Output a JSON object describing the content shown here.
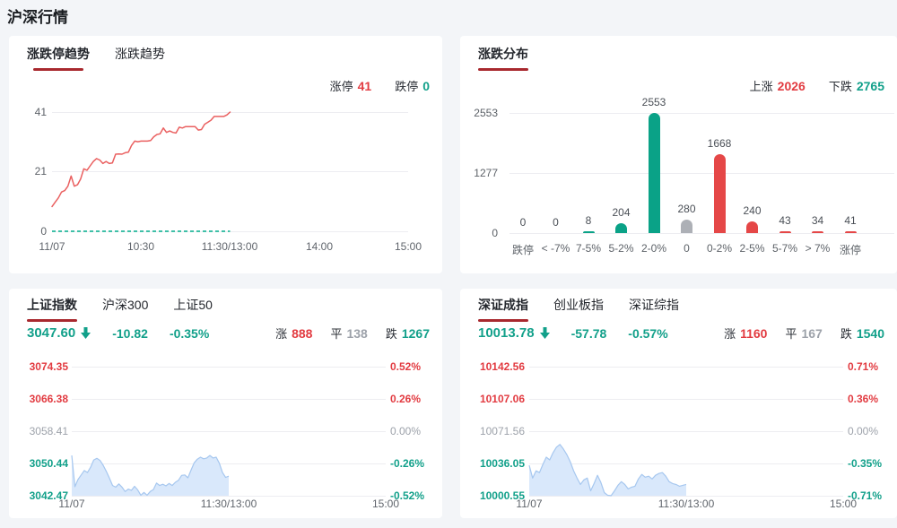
{
  "page": {
    "title": "沪深行情"
  },
  "colors": {
    "up": "#e23b41",
    "down": "#12a08a",
    "flat": "#9da2aa",
    "tab_underline": "#a8282e",
    "line_red": "#ea6060",
    "line_teal": "#3fc0a7",
    "bar_up": "#e54747",
    "bar_down": "#0aa287",
    "bar_flat": "#adb0b6",
    "area_fill": "#d9e8fb",
    "area_stroke": "#a6c7ef"
  },
  "panels": {
    "limit_trend": {
      "tabs": [
        "涨跌停趋势",
        "涨跌趋势"
      ],
      "stats": {
        "up_label": "涨停",
        "up_value": "41",
        "down_label": "跌停",
        "down_value": "0"
      },
      "chart": {
        "type": "line",
        "ymax": 41,
        "yticks": [
          "41",
          "21",
          "0"
        ],
        "xticks": [
          "11/07",
          "10:30",
          "11:30/13:00",
          "14:00",
          "15:00"
        ],
        "time_fraction_end": 0.5,
        "series": [
          {
            "name": "涨停",
            "tone": "up",
            "values": [
              8.5,
              10,
              11.5,
              13.5,
              14,
              15.5,
              19,
              15.5,
              16,
              18,
              21.5,
              21,
              22.5,
              24,
              25,
              24.5,
              23.3,
              24,
              23.3,
              23.5,
              26.5,
              26.6,
              26.5,
              27,
              27.2,
              29.5,
              31,
              30.8,
              31,
              31,
              31,
              31.2,
              32.5,
              33.3,
              33.5,
              35.5,
              34,
              34.5,
              34,
              33.8,
              35.8,
              35.5,
              36,
              36,
              36,
              36,
              34.8,
              35,
              36.8,
              37.5,
              38.2,
              39.5,
              39.5,
              39.5,
              39.5,
              40,
              41
            ]
          },
          {
            "name": "跌停",
            "tone": "down",
            "values": [
              0,
              0
            ]
          }
        ]
      }
    },
    "distribution": {
      "tabs": [
        "涨跌分布"
      ],
      "stats": {
        "up_label": "上涨",
        "up_value": "2026",
        "down_label": "下跌",
        "down_value": "2765"
      },
      "chart": {
        "type": "bar",
        "ymax": 2553,
        "yticks": [
          "2553",
          "1277",
          "0"
        ],
        "categories": [
          "跌停",
          "< -7%",
          "7-5%",
          "5-2%",
          "2-0%",
          "0",
          "0-2%",
          "2-5%",
          "5-7%",
          "> 7%",
          "涨停"
        ],
        "values": [
          0,
          0,
          8,
          204,
          2553,
          280,
          1668,
          240,
          43,
          34,
          41
        ],
        "bar_tones": [
          "down",
          "down",
          "down",
          "down",
          "down",
          "flat",
          "up",
          "up",
          "up",
          "up",
          "up"
        ]
      }
    },
    "sh_index": {
      "tabs": [
        "上证指数",
        "沪深300",
        "上证50"
      ],
      "quote": {
        "value": "3047.60",
        "change": "-10.82",
        "pct": "-0.35%",
        "direction": "down"
      },
      "stats": {
        "up_label": "涨",
        "up_value": "888",
        "flat_label": "平",
        "flat_value": "138",
        "down_label": "跌",
        "down_value": "1267"
      },
      "chart": {
        "type": "area",
        "ymin": 3042.47,
        "ymax": 3074.35,
        "left_ticks": [
          "3074.35",
          "3066.38",
          "3058.41",
          "3050.44",
          "3042.47"
        ],
        "right_ticks": [
          "0.52%",
          "0.26%",
          "0.00%",
          "-0.26%",
          "-0.52%"
        ],
        "xticks": [
          "11/07",
          "11:30/13:00",
          "15:00"
        ],
        "time_fraction_end": 0.5,
        "values": [
          3052.4,
          3044.7,
          3046.5,
          3047.6,
          3048.7,
          3048.2,
          3049.5,
          3051.3,
          3051.7,
          3051.2,
          3050.0,
          3048.5,
          3046.8,
          3045.0,
          3044.6,
          3045.4,
          3044.6,
          3043.5,
          3044.1,
          3043.8,
          3044.8,
          3043.9,
          3042.6,
          3043.3,
          3042.6,
          3043.5,
          3044.0,
          3045.6,
          3045.0,
          3045.3,
          3044.9,
          3045.5,
          3045.0,
          3045.8,
          3046.3,
          3047.5,
          3047.6,
          3046.9,
          3048.8,
          3050.6,
          3051.5,
          3052.0,
          3051.6,
          3051.8,
          3052.4,
          3051.8,
          3052.0,
          3050.5,
          3048.2,
          3047.0,
          3047.3
        ]
      }
    },
    "sz_index": {
      "tabs": [
        "深证成指",
        "创业板指",
        "深证综指"
      ],
      "quote": {
        "value": "10013.78",
        "change": "-57.78",
        "pct": "-0.57%",
        "direction": "down"
      },
      "stats": {
        "up_label": "涨",
        "up_value": "1160",
        "flat_label": "平",
        "flat_value": "167",
        "down_label": "跌",
        "down_value": "1540"
      },
      "chart": {
        "type": "area",
        "ymin": 10000.55,
        "ymax": 10142.56,
        "left_ticks": [
          "10142.56",
          "10107.06",
          "10071.56",
          "10036.05",
          "10000.55"
        ],
        "right_ticks": [
          "0.71%",
          "0.36%",
          "0.00%",
          "-0.35%",
          "-0.71%"
        ],
        "xticks": [
          "11/07",
          "11:30/13:00",
          "15:00"
        ],
        "time_fraction_end": 0.5,
        "values": [
          10034,
          10020,
          10028,
          10026,
          10035,
          10043,
          10040,
          10048,
          10054,
          10057,
          10052,
          10046,
          10038,
          10028,
          10020,
          10013,
          10018,
          10020,
          10006,
          10014,
          10023,
          10015,
          10004,
          10001,
          10000.6,
          10006,
          10012,
          10016,
          10013,
          10008,
          10010,
          10011,
          10019,
          10024,
          10021,
          10022,
          10019,
          10023,
          10025,
          10026,
          10022,
          10016,
          10014,
          10013,
          10011,
          10012,
          10013
        ]
      }
    }
  }
}
